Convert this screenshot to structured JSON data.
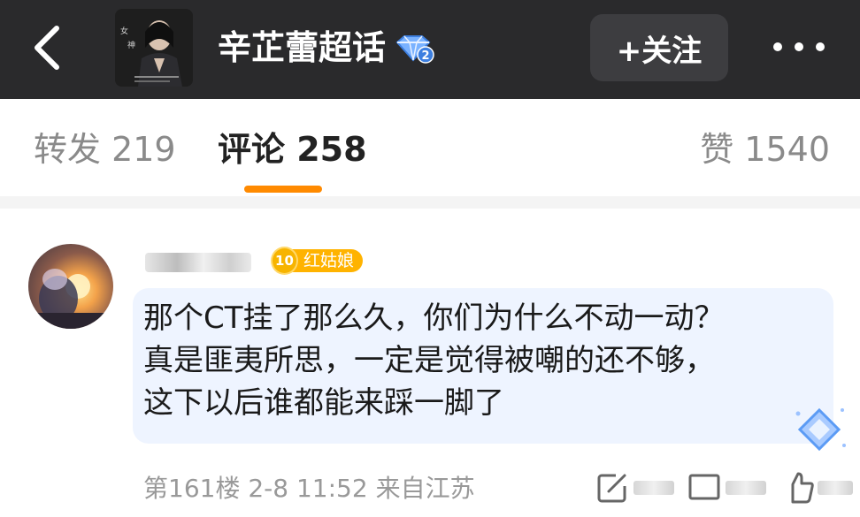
{
  "header": {
    "title": "辛芷蕾超话",
    "vip_level": "2",
    "follow_label": "+关注"
  },
  "tabs": {
    "repost": "转发 219",
    "comment": "评论 258",
    "like": "赞 1540"
  },
  "comment": {
    "badge_level": "10",
    "badge_label": "红姑娘",
    "lines": [
      "那个CT挂了那么久，你们为什么不动一动？",
      "真是匪夷所思，一定是觉得被嘲的还不够，",
      "这下以后谁都能来踩一脚了"
    ],
    "meta": "第161楼  2-8 11:52  来自江苏"
  },
  "colors": {
    "header_bg": "#2a2a2c",
    "accent": "#ff8a00",
    "bubble_bg": "#eef4ff"
  }
}
